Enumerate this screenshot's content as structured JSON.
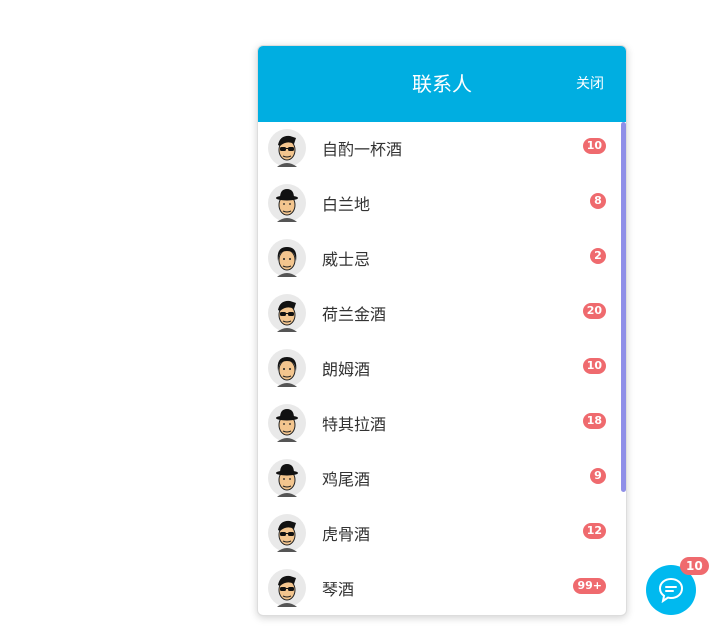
{
  "panel": {
    "title": "联系人",
    "close_label": "关闭"
  },
  "contacts": [
    {
      "name": "自酌一杯酒",
      "badge": "10",
      "avatar": "sunglasses-guy-icon"
    },
    {
      "name": "白兰地",
      "badge": "8",
      "avatar": "hat-guy-icon"
    },
    {
      "name": "威士忌",
      "badge": "2",
      "avatar": "curly-hair-guy-icon"
    },
    {
      "name": "荷兰金酒",
      "badge": "20",
      "avatar": "sunglasses-guy-icon"
    },
    {
      "name": "朗姆酒",
      "badge": "10",
      "avatar": "curly-hair-guy-icon"
    },
    {
      "name": "特其拉酒",
      "badge": "18",
      "avatar": "hat-guy-icon"
    },
    {
      "name": "鸡尾酒",
      "badge": "9",
      "avatar": "hat-guy-icon"
    },
    {
      "name": "虎骨酒",
      "badge": "12",
      "avatar": "sunglasses-guy-icon"
    },
    {
      "name": "琴酒",
      "badge": "99+",
      "avatar": "sunglasses-guy-icon"
    }
  ],
  "chat_fab": {
    "badge": "10",
    "icon": "chat-bubble-icon"
  },
  "colors": {
    "header": "#00aee1",
    "badge": "#ef6a6e",
    "scrollbar": "#8f8fe8",
    "fab": "#00b9ef"
  }
}
